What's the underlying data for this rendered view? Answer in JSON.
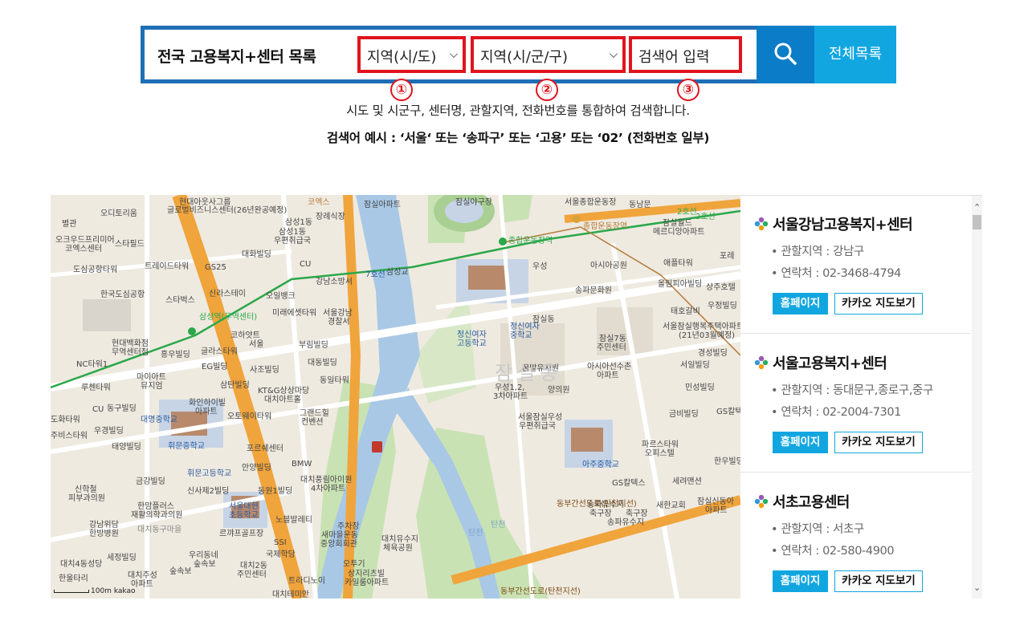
{
  "search": {
    "title": "전국 고용복지+센터 목록",
    "region_sido": "지역(시/도)",
    "region_sigungu": "지역(시/군/구)",
    "keyword_placeholder": "검색어 입력",
    "all_list_label": "전체목록",
    "markers": [
      "①",
      "②",
      "③"
    ]
  },
  "description": {
    "line1": "시도 및 시군구, 센터명, 관할지역, 전화번호를 통합하여 검색합니다.",
    "line2": "검색어 예시 : ‘서울‘ 또는 ‘송파구’ 또는 ‘고용’ 또는 ‘02’ (전화번호 일부)"
  },
  "map": {
    "scale_label": "100m",
    "provider": "kakao",
    "labels": {
      "l1": "현대아웃사그룹",
      "l2": "글로벌비즈니스센터(26년완공예정)",
      "l3": "오디토리움",
      "l4": "별관",
      "l5": "오크우드프리미어",
      "l6": "코엑스센터",
      "l7": "스타필드",
      "l8": "삼성1동",
      "l9": "우편취급국",
      "l10": "대화빌딩",
      "l11": "GS25",
      "l12": "트레이드타워",
      "l13": "도심공항타워",
      "l14": "한국도심공항",
      "l15": "스타벅스",
      "l16": "신라스테이",
      "l17": "오일뱅크",
      "l18": "미래에셋타워",
      "l19": "서울강남",
      "l20": "경찰서",
      "l21": "삼성역(무역센터)",
      "l22": "현대백화점",
      "l23": "무역센터점",
      "l24": "코하얏트",
      "l25": "서울",
      "l26": "흥우빌딩",
      "l27": "글라스타워",
      "l28": "부림빌딩",
      "l29": "대동빌딩",
      "l30": "NC타워1",
      "l31": "EG빌딩",
      "l32": "사조빌딩",
      "l33": "동일타워",
      "l34": "마이아트",
      "l35": "뮤지엄",
      "l36": "루첸타워",
      "l37": "삼탄빌딩",
      "l38": "KT&G상상마당",
      "l39": "대치아트홀",
      "l40": "동구빌딩",
      "l41": "화인하이빌",
      "l42": "아파트",
      "l43": "그랜드힐",
      "l44": "컨벤션",
      "l45": "대명중학교",
      "l46": "오토웨이타워",
      "l47": "휘문중학교",
      "l48": "포르쉐센터",
      "l49": "태양빌딩",
      "l50": "우경빌딩",
      "l51": "도화타워",
      "l52": "주비스타워",
      "l53": "휘문고등학교",
      "l54": "안양빌딩",
      "l55": "BMW",
      "l56": "금강빌딩",
      "l57": "신사제2빌딩",
      "l58": "동원1빌딩",
      "l59": "대치풍림아이원",
      "l60": "4차아파트",
      "l61": "신학철",
      "l62": "피부과의원",
      "l63": "한맘플러스",
      "l64": "재활의학과의원",
      "l65": "서울대현",
      "l66": "초등학교",
      "l67": "노블발레티",
      "l68": "강남위담",
      "l69": "한방병원",
      "l70": "대치동구마을",
      "l71": "르꺄프골프장",
      "l72": "SSI",
      "l73": "국제학당",
      "l74": "새마을운동",
      "l75": "중앙회회관",
      "l76": "대치유수지",
      "l77": "체육공원",
      "l78": "세정빌딩",
      "l79": "우리동네",
      "l80": "숲속보",
      "l81": "대치2동",
      "l82": "주민센터",
      "l83": "트라디노이",
      "l84": "오투기",
      "l85": "상지리츠빌",
      "l86": "카일룸아파트",
      "l87": "대치4동성당",
      "l88": "한울타리",
      "l89": "대치주성",
      "l90": "아파트",
      "l91": "대치테미안",
      "l92": "잠실야구장",
      "l93": "서울종합운동장",
      "l94": "동남문",
      "l95": "잠실월드",
      "l96": "메르디앙아파트",
      "l97": "2호선",
      "l98": "종합운동장역",
      "l99": "종합운동장역",
      "l100": "삼성교",
      "l101": "강남소방서",
      "l102": "7호선",
      "l103": "아시아공원",
      "l104": "애플타워",
      "l105": "올림피아빌딩",
      "l106": "상주호텔",
      "l107": "우정빌딩",
      "l108": "태호갈비",
      "l109": "송파문화원",
      "l110": "서울잠실행복주택아파트",
      "l111": "(21년03월예정)",
      "l112": "정신여자",
      "l113": "고등학교",
      "l114": "정신여자",
      "l115": "중학교",
      "l116": "잠실7동",
      "l117": "주민센터",
      "l118": "경성빌딩",
      "l119": "서일빌딩",
      "l120": "꿈밭유치원",
      "l121": "아시아선수촌",
      "l122": "아파트",
      "l123": "잠실동",
      "l124": "우성1,2,",
      "l125": "3차아파트",
      "l126": "양의원",
      "l127": "민성빌딩",
      "l128": "서울잠실우성",
      "l129": "우편취급국",
      "l130": "금비빌딩",
      "l131": "GS칼텍",
      "l132": "파르스타워",
      "l133": "오피스텔",
      "l134": "아주중학교",
      "l135": "한우빌딩",
      "l136": "GS칼텍스",
      "l137": "세려맨션",
      "l138": "송파유수지",
      "l139": "축구장",
      "l140": "축구장",
      "l141": "새한교회",
      "l142": "잠실신동아",
      "l143": "아파트",
      "l144": "송파유수지",
      "l145": "탄천",
      "l146": "동부간선도로(탄천지선)",
      "l147": "동부간선도로(탄천지선)",
      "l148": "잠실아파트",
      "l149": "포레",
      "l150": "코엑스",
      "l151": "장례식장",
      "l152": "삼성1동",
      "l153": "CU",
      "l154": "CU",
      "l155": "우성",
      "l156": "탄천",
      "l157": "2호선",
      "l158": "주차장",
      "l159": "잠실동",
      "l160": "숲속보"
    }
  },
  "centers": [
    {
      "name": "서울강남고용복지+센터",
      "region": "• 관할지역 : 강남구",
      "phone": "• 연락처 : 02-3468-4794",
      "home_label": "홈페이지",
      "map_label": "카카오 지도보기"
    },
    {
      "name": "서울고용복지+센터",
      "region": "• 관할지역 : 동대문구,종로구,중구",
      "phone": "• 연락처 : 02-2004-7301",
      "home_label": "홈페이지",
      "map_label": "카카오 지도보기"
    },
    {
      "name": "서초고용센터",
      "region": "• 관할지역 : 서초구",
      "phone": "• 연락처 : 02-580-4900",
      "home_label": "홈페이지",
      "map_label": "카카오 지도보기"
    }
  ],
  "colors": {
    "frame": "#1f6fb5",
    "highlight": "#e0141e",
    "search_btn": "#0b7cc7",
    "accent": "#12a6e0"
  },
  "icons": {
    "search": "search-icon",
    "dropdown": "chevron-down-icon",
    "center_logo": "center-logo-icon",
    "scroll_up": "scroll-up-icon",
    "scroll_down": "scroll-down-icon"
  }
}
